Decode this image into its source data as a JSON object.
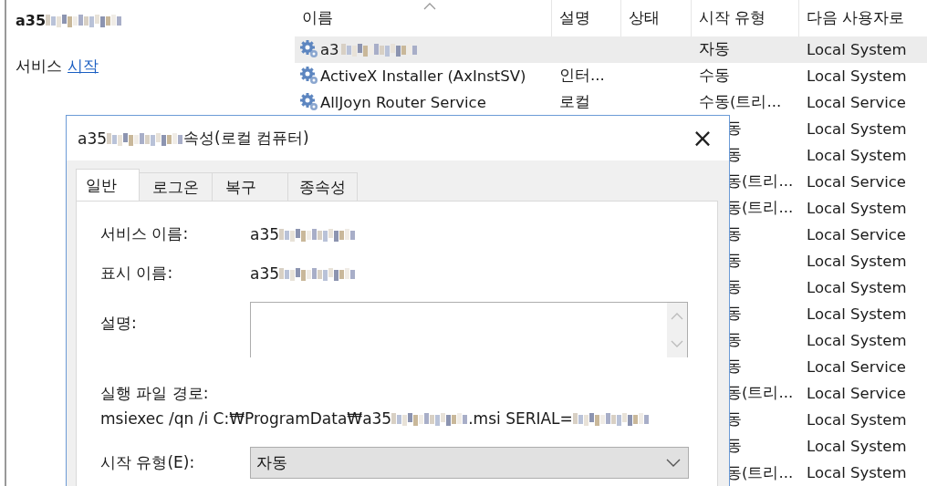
{
  "left_panel": {
    "title": [
      "a35",
      {
        "kind": "redacted"
      }
    ],
    "action_text": "서비스",
    "action_link": "시작"
  },
  "table": {
    "columns": [
      {
        "label": "이름",
        "sorted": true
      },
      {
        "label": "설명",
        "sorted": false
      },
      {
        "label": "상태",
        "sorted": false
      },
      {
        "label": "시작 유형",
        "sorted": false
      },
      {
        "label": "다음 사용자로",
        "sorted": false
      }
    ],
    "rows": [
      {
        "name": [
          "a3",
          {
            "kind": "redacted"
          }
        ],
        "selected": true,
        "startup_type": "자동",
        "account": "Local System"
      },
      {
        "name": [
          "ActiveX Installer (AxInstSV)"
        ],
        "description": "인터...",
        "selected": false,
        "startup_type": "수동",
        "account": "Local System"
      },
      {
        "name": [
          "AllJoyn Router Service"
        ],
        "description": "로컬",
        "selected": false,
        "startup_type": "수동(트리...",
        "account": "Local Service"
      },
      {
        "selected": false,
        "startup_type": "동",
        "account": "Local System"
      },
      {
        "selected": false,
        "startup_type": "동",
        "account": "Local System"
      },
      {
        "selected": false,
        "startup_type": "동(트리...",
        "account": "Local Service"
      },
      {
        "selected": false,
        "startup_type": "동(트리...",
        "account": "Local System"
      },
      {
        "selected": false,
        "startup_type": "동",
        "account": "Local Service"
      },
      {
        "selected": false,
        "startup_type": "동",
        "account": "Local System"
      },
      {
        "selected": false,
        "startup_type": "동",
        "account": "Local System"
      },
      {
        "selected": false,
        "startup_type": "동",
        "account": "Local System"
      },
      {
        "selected": false,
        "startup_type": "동",
        "account": "Local System"
      },
      {
        "selected": false,
        "startup_type": "동",
        "account": "Local Service"
      },
      {
        "selected": false,
        "startup_type": "동(트리...",
        "account": "Local Service"
      },
      {
        "selected": false,
        "startup_type": "동",
        "account": "Local System"
      },
      {
        "selected": false,
        "startup_type": "동",
        "account": "Local System"
      },
      {
        "selected": false,
        "startup_type": "동(트리...",
        "account": "Local System"
      }
    ]
  },
  "dialog": {
    "title": [
      "a35",
      {
        "kind": "redacted"
      },
      "속성(로컬 컴퓨터)"
    ],
    "close": "×",
    "tabs": [
      {
        "label": "일반",
        "selected": true
      },
      {
        "label": "로그온",
        "selected": false
      },
      {
        "label": "복구",
        "selected": false
      },
      {
        "label": "종속성",
        "selected": false
      }
    ],
    "service_name": {
      "label": "서비스 이름:",
      "value": [
        "a35",
        {
          "kind": "redacted"
        }
      ]
    },
    "display_name": {
      "label": "표시 이름:",
      "value": [
        "a35",
        {
          "kind": "redacted"
        }
      ]
    },
    "description": {
      "label": "설명:"
    },
    "path": {
      "label": "실행 파일 경로:",
      "value": [
        "msiexec /qn /i C:₩ProgramData₩a35",
        {
          "kind": "redacted"
        },
        ".msi SERIAL=",
        {
          "kind": "redacted"
        }
      ]
    },
    "startup_type": {
      "label": "시작 유형(E):",
      "value": "자동"
    }
  }
}
